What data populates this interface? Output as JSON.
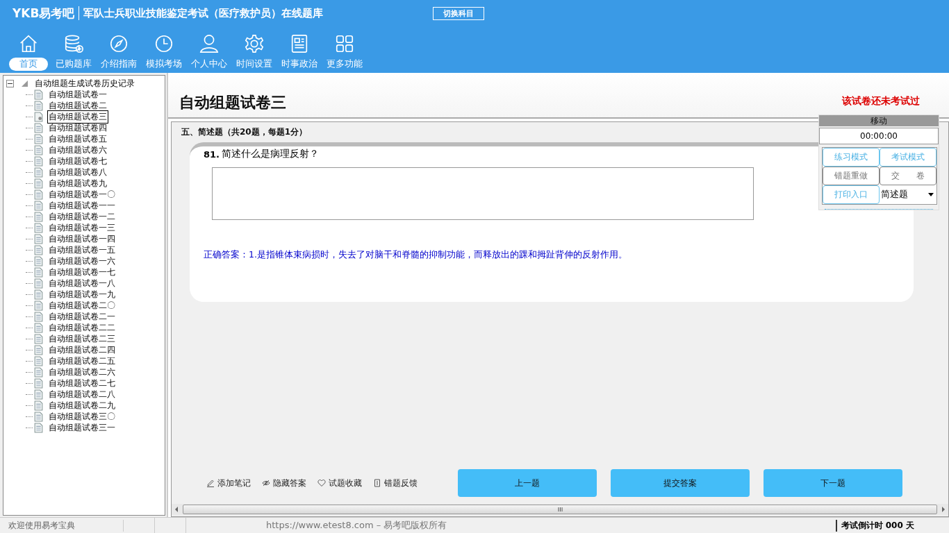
{
  "header": {
    "logo": "YKB易考吧",
    "title": "军队士兵职业技能鉴定考试（医疗救护员）在线题库",
    "switch_button": "切换科目"
  },
  "nav": [
    {
      "label": "首页",
      "selected": true
    },
    {
      "label": "已购题库",
      "selected": false
    },
    {
      "label": "介绍指南",
      "selected": false
    },
    {
      "label": "模拟考场",
      "selected": false
    },
    {
      "label": "个人中心",
      "selected": false
    },
    {
      "label": "时间设置",
      "selected": false
    },
    {
      "label": "时事政治",
      "selected": false
    },
    {
      "label": "更多功能",
      "selected": false
    }
  ],
  "tree": {
    "label": "自动组题生成试卷历史记录",
    "expanded": true,
    "children": [
      {
        "label": "自动组题试卷一",
        "selected": false
      },
      {
        "label": "自动组题试卷二",
        "selected": false
      },
      {
        "label": "自动组题试卷三",
        "selected": true
      },
      {
        "label": "自动组题试卷四",
        "selected": false
      },
      {
        "label": "自动组题试卷五",
        "selected": false
      },
      {
        "label": "自动组题试卷六",
        "selected": false
      },
      {
        "label": "自动组题试卷七",
        "selected": false
      },
      {
        "label": "自动组题试卷八",
        "selected": false
      },
      {
        "label": "自动组题试卷九",
        "selected": false
      },
      {
        "label": "自动组题试卷一〇",
        "selected": false
      },
      {
        "label": "自动组题试卷一一",
        "selected": false
      },
      {
        "label": "自动组题试卷一二",
        "selected": false
      },
      {
        "label": "自动组题试卷一三",
        "selected": false
      },
      {
        "label": "自动组题试卷一四",
        "selected": false
      },
      {
        "label": "自动组题试卷一五",
        "selected": false
      },
      {
        "label": "自动组题试卷一六",
        "selected": false
      },
      {
        "label": "自动组题试卷一七",
        "selected": false
      },
      {
        "label": "自动组题试卷一八",
        "selected": false
      },
      {
        "label": "自动组题试卷一九",
        "selected": false
      },
      {
        "label": "自动组题试卷二〇",
        "selected": false
      },
      {
        "label": "自动组题试卷二一",
        "selected": false
      },
      {
        "label": "自动组题试卷二二",
        "selected": false
      },
      {
        "label": "自动组题试卷二三",
        "selected": false
      },
      {
        "label": "自动组题试卷二四",
        "selected": false
      },
      {
        "label": "自动组题试卷二五",
        "selected": false
      },
      {
        "label": "自动组题试卷二六",
        "selected": false
      },
      {
        "label": "自动组题试卷二七",
        "selected": false
      },
      {
        "label": "自动组题试卷二八",
        "selected": false
      },
      {
        "label": "自动组题试卷二九",
        "selected": false
      },
      {
        "label": "自动组题试卷三〇",
        "selected": false
      },
      {
        "label": "自动组题试卷三一",
        "selected": false
      }
    ]
  },
  "paper": {
    "title": "自动组题试卷三",
    "status": "该试卷还未考试过",
    "section": "五、简述题（共20题，每题1分）",
    "question_number": "81.",
    "question": "简述什么是病理反射？",
    "answer": "正确答案：1.是指锥体束病损时，失去了对脑干和脊髓的抑制功能，而释放出的踝和拇趾背伸的反射作用。"
  },
  "tools": [
    "添加笔记",
    "隐藏答案",
    "试题收藏",
    "错题反馈"
  ],
  "buttons": [
    "上一题",
    "提交答案",
    "下一题"
  ],
  "control_panel": {
    "header": "移动",
    "timer": "00:00:00",
    "buttons": [
      {
        "label": "练习模式",
        "kind": "blue"
      },
      {
        "label": "考试模式",
        "kind": "blue"
      },
      {
        "label": "错题重做",
        "kind": "grey"
      },
      {
        "label": "交　　卷",
        "kind": "grey"
      },
      {
        "label": "打印入口",
        "kind": "blue"
      }
    ],
    "dropdown": "简述题"
  },
  "status_bar": {
    "welcome": "欢迎使用易考宝典",
    "copyright": "https://www.etest8.com – 易考吧版权所有",
    "countdown": "考试倒计时 000 天"
  }
}
